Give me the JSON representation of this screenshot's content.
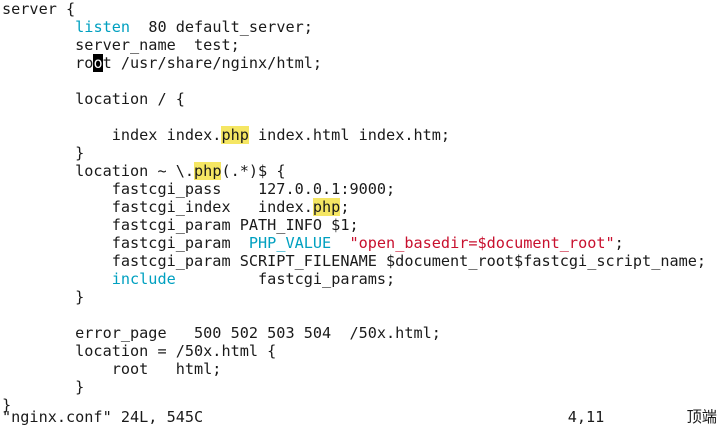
{
  "colors": {
    "text": "#1a1a1a",
    "keyword": "#00a0c0",
    "string": "#c8102e",
    "search_highlight": "#f5e663",
    "cursor_bg": "#000000",
    "cursor_fg": "#ffffff"
  },
  "lines": [
    [
      {
        "t": "server {"
      }
    ],
    [
      {
        "t": "        "
      },
      {
        "t": "listen",
        "s": "keyword"
      },
      {
        "t": "  80 default_server;"
      }
    ],
    [
      {
        "t": "        server_name  test;"
      }
    ],
    [
      {
        "t": "        ro"
      },
      {
        "t": "o",
        "s": "cursor"
      },
      {
        "t": "t /usr/share/nginx/html;"
      }
    ],
    [
      {
        "t": ""
      }
    ],
    [
      {
        "t": "        location / {"
      }
    ],
    [
      {
        "t": ""
      }
    ],
    [
      {
        "t": "            index index."
      },
      {
        "t": "php",
        "s": "hl"
      },
      {
        "t": " index.html index.htm;"
      }
    ],
    [
      {
        "t": "        }"
      }
    ],
    [
      {
        "t": "        location ~ \\."
      },
      {
        "t": "php",
        "s": "hl"
      },
      {
        "t": "(.*)$ {"
      }
    ],
    [
      {
        "t": "            fastcgi_pass    127.0.0.1:9000;"
      }
    ],
    [
      {
        "t": "            fastcgi_index   index."
      },
      {
        "t": "php",
        "s": "hl"
      },
      {
        "t": ";"
      }
    ],
    [
      {
        "t": "            fastcgi_param PATH_INFO $1;"
      }
    ],
    [
      {
        "t": "            fastcgi_param  "
      },
      {
        "t": "PHP_VALUE",
        "s": "keyword"
      },
      {
        "t": "  "
      },
      {
        "t": "\"open_basedir=$document_root\"",
        "s": "string"
      },
      {
        "t": ";"
      }
    ],
    [
      {
        "t": "            fastcgi_param SCRIPT_FILENAME $document_root$fastcgi_script_name;"
      }
    ],
    [
      {
        "t": "            "
      },
      {
        "t": "include",
        "s": "keyword"
      },
      {
        "t": "         fastcgi_params;"
      }
    ],
    [
      {
        "t": "        }"
      }
    ],
    [
      {
        "t": ""
      }
    ],
    [
      {
        "t": "        error_page   500 502 503 504  /50x.html;"
      }
    ],
    [
      {
        "t": "        location = /50x.html {"
      }
    ],
    [
      {
        "t": "            root   html;"
      }
    ],
    [
      {
        "t": "        }"
      }
    ],
    [
      {
        "t": "}"
      }
    ]
  ],
  "status": {
    "left": "\"nginx.conf\" 24L, 545C",
    "right": "4,11         顶端"
  }
}
